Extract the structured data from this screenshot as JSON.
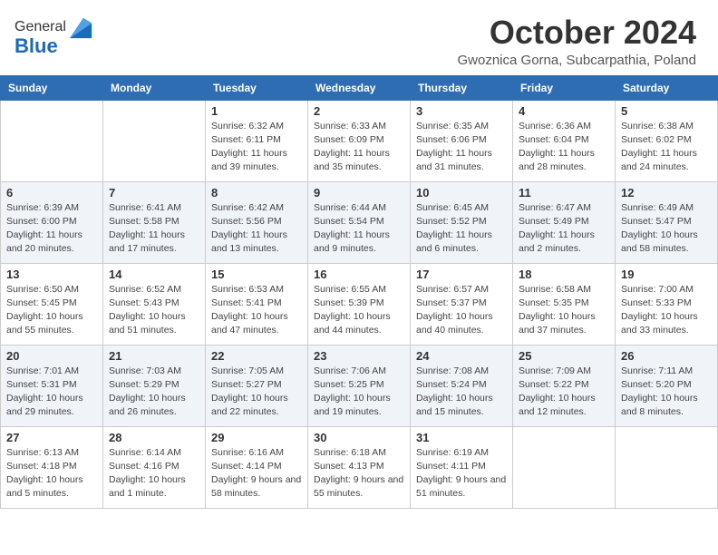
{
  "header": {
    "logo_general": "General",
    "logo_blue": "Blue",
    "month_title": "October 2024",
    "location": "Gwoznica Gorna, Subcarpathia, Poland"
  },
  "days_of_week": [
    "Sunday",
    "Monday",
    "Tuesday",
    "Wednesday",
    "Thursday",
    "Friday",
    "Saturday"
  ],
  "weeks": [
    [
      {
        "day": "",
        "info": ""
      },
      {
        "day": "",
        "info": ""
      },
      {
        "day": "1",
        "info": "Sunrise: 6:32 AM\nSunset: 6:11 PM\nDaylight: 11 hours\nand 39 minutes."
      },
      {
        "day": "2",
        "info": "Sunrise: 6:33 AM\nSunset: 6:09 PM\nDaylight: 11 hours\nand 35 minutes."
      },
      {
        "day": "3",
        "info": "Sunrise: 6:35 AM\nSunset: 6:06 PM\nDaylight: 11 hours\nand 31 minutes."
      },
      {
        "day": "4",
        "info": "Sunrise: 6:36 AM\nSunset: 6:04 PM\nDaylight: 11 hours\nand 28 minutes."
      },
      {
        "day": "5",
        "info": "Sunrise: 6:38 AM\nSunset: 6:02 PM\nDaylight: 11 hours\nand 24 minutes."
      }
    ],
    [
      {
        "day": "6",
        "info": "Sunrise: 6:39 AM\nSunset: 6:00 PM\nDaylight: 11 hours\nand 20 minutes."
      },
      {
        "day": "7",
        "info": "Sunrise: 6:41 AM\nSunset: 5:58 PM\nDaylight: 11 hours\nand 17 minutes."
      },
      {
        "day": "8",
        "info": "Sunrise: 6:42 AM\nSunset: 5:56 PM\nDaylight: 11 hours\nand 13 minutes."
      },
      {
        "day": "9",
        "info": "Sunrise: 6:44 AM\nSunset: 5:54 PM\nDaylight: 11 hours\nand 9 minutes."
      },
      {
        "day": "10",
        "info": "Sunrise: 6:45 AM\nSunset: 5:52 PM\nDaylight: 11 hours\nand 6 minutes."
      },
      {
        "day": "11",
        "info": "Sunrise: 6:47 AM\nSunset: 5:49 PM\nDaylight: 11 hours\nand 2 minutes."
      },
      {
        "day": "12",
        "info": "Sunrise: 6:49 AM\nSunset: 5:47 PM\nDaylight: 10 hours\nand 58 minutes."
      }
    ],
    [
      {
        "day": "13",
        "info": "Sunrise: 6:50 AM\nSunset: 5:45 PM\nDaylight: 10 hours\nand 55 minutes."
      },
      {
        "day": "14",
        "info": "Sunrise: 6:52 AM\nSunset: 5:43 PM\nDaylight: 10 hours\nand 51 minutes."
      },
      {
        "day": "15",
        "info": "Sunrise: 6:53 AM\nSunset: 5:41 PM\nDaylight: 10 hours\nand 47 minutes."
      },
      {
        "day": "16",
        "info": "Sunrise: 6:55 AM\nSunset: 5:39 PM\nDaylight: 10 hours\nand 44 minutes."
      },
      {
        "day": "17",
        "info": "Sunrise: 6:57 AM\nSunset: 5:37 PM\nDaylight: 10 hours\nand 40 minutes."
      },
      {
        "day": "18",
        "info": "Sunrise: 6:58 AM\nSunset: 5:35 PM\nDaylight: 10 hours\nand 37 minutes."
      },
      {
        "day": "19",
        "info": "Sunrise: 7:00 AM\nSunset: 5:33 PM\nDaylight: 10 hours\nand 33 minutes."
      }
    ],
    [
      {
        "day": "20",
        "info": "Sunrise: 7:01 AM\nSunset: 5:31 PM\nDaylight: 10 hours\nand 29 minutes."
      },
      {
        "day": "21",
        "info": "Sunrise: 7:03 AM\nSunset: 5:29 PM\nDaylight: 10 hours\nand 26 minutes."
      },
      {
        "day": "22",
        "info": "Sunrise: 7:05 AM\nSunset: 5:27 PM\nDaylight: 10 hours\nand 22 minutes."
      },
      {
        "day": "23",
        "info": "Sunrise: 7:06 AM\nSunset: 5:25 PM\nDaylight: 10 hours\nand 19 minutes."
      },
      {
        "day": "24",
        "info": "Sunrise: 7:08 AM\nSunset: 5:24 PM\nDaylight: 10 hours\nand 15 minutes."
      },
      {
        "day": "25",
        "info": "Sunrise: 7:09 AM\nSunset: 5:22 PM\nDaylight: 10 hours\nand 12 minutes."
      },
      {
        "day": "26",
        "info": "Sunrise: 7:11 AM\nSunset: 5:20 PM\nDaylight: 10 hours\nand 8 minutes."
      }
    ],
    [
      {
        "day": "27",
        "info": "Sunrise: 6:13 AM\nSunset: 4:18 PM\nDaylight: 10 hours\nand 5 minutes."
      },
      {
        "day": "28",
        "info": "Sunrise: 6:14 AM\nSunset: 4:16 PM\nDaylight: 10 hours\nand 1 minute."
      },
      {
        "day": "29",
        "info": "Sunrise: 6:16 AM\nSunset: 4:14 PM\nDaylight: 9 hours\nand 58 minutes."
      },
      {
        "day": "30",
        "info": "Sunrise: 6:18 AM\nSunset: 4:13 PM\nDaylight: 9 hours\nand 55 minutes."
      },
      {
        "day": "31",
        "info": "Sunrise: 6:19 AM\nSunset: 4:11 PM\nDaylight: 9 hours\nand 51 minutes."
      },
      {
        "day": "",
        "info": ""
      },
      {
        "day": "",
        "info": ""
      }
    ]
  ]
}
